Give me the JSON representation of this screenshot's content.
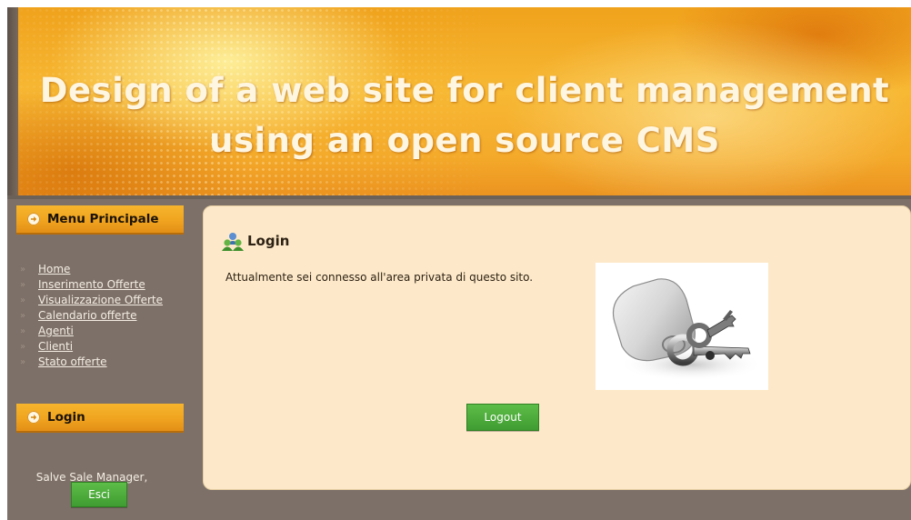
{
  "header": {
    "title_line1": "Design of a web site for client management",
    "title_line2": "using an open source CMS"
  },
  "sidebar": {
    "menu_heading": "Menu Principale",
    "menu_items": [
      {
        "label": "Home"
      },
      {
        "label": "Inserimento Offerte"
      },
      {
        "label": "Visualizzazione Offerte"
      },
      {
        "label": "Calendario offerte"
      },
      {
        "label": "Agenti"
      },
      {
        "label": "Clienti"
      },
      {
        "label": "Stato offerte"
      }
    ],
    "login_heading": "Login",
    "greeting": "Salve Sale Manager,",
    "logout_button": "Esci"
  },
  "content": {
    "title": "Login",
    "message": "Attualmente sei connesso all'area privata di questo sito.",
    "logout_button": "Logout",
    "image_icon": "keys-icon",
    "title_icon": "users-icon"
  },
  "colors": {
    "header_orange": "#f4a92a",
    "sidebar_bg": "#7d7068",
    "panel_bg": "#fde9c9",
    "button_green": "#4aa83a"
  }
}
